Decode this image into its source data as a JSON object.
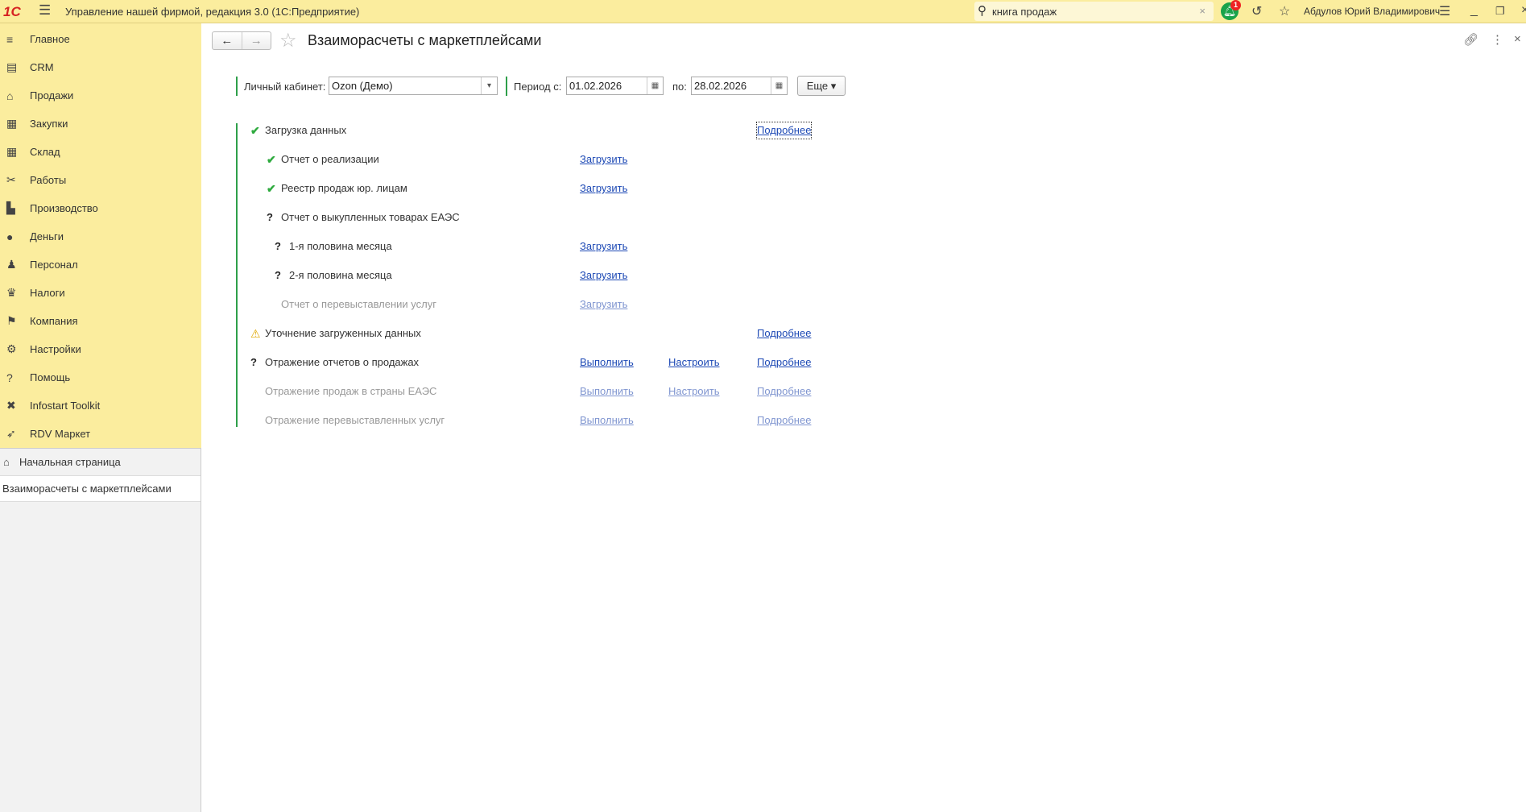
{
  "app": {
    "logo": "1С",
    "title": "Управление нашей фирмой, редакция 3.0  (1С:Предприятие)",
    "search_value": "книга продаж",
    "notifications": "1",
    "user": "Абдулов Юрий Владимирович"
  },
  "sidebar": {
    "items": [
      {
        "label": "Главное",
        "icon": "≡"
      },
      {
        "label": "CRM",
        "icon": "▤"
      },
      {
        "label": "Продажи",
        "icon": "⌂"
      },
      {
        "label": "Закупки",
        "icon": "▦"
      },
      {
        "label": "Склад",
        "icon": "▦"
      },
      {
        "label": "Работы",
        "icon": "✂"
      },
      {
        "label": "Производство",
        "icon": "▙"
      },
      {
        "label": "Деньги",
        "icon": "●"
      },
      {
        "label": "Персонал",
        "icon": "♟"
      },
      {
        "label": "Налоги",
        "icon": "♛"
      },
      {
        "label": "Компания",
        "icon": "⚑"
      },
      {
        "label": "Настройки",
        "icon": "⚙"
      },
      {
        "label": "Помощь",
        "icon": "?"
      },
      {
        "label": "Infostart Toolkit",
        "icon": "✖"
      },
      {
        "label": "RDV Маркет",
        "icon": "➶"
      }
    ],
    "home": "Начальная страница",
    "open_form": "Взаиморасчеты с маркетплейсами"
  },
  "form": {
    "title": "Взаиморасчеты с маркетплейсами",
    "cabinet_label": "Личный кабинет:",
    "cabinet_value": "Ozon (Демо)",
    "period_from_label": "Период с:",
    "period_from": "01.02.2026",
    "period_to_label": "по:",
    "period_to": "28.02.2026",
    "more_label": "Еще"
  },
  "tree": [
    {
      "text": "Загрузка данных",
      "status": "ok",
      "level": 0,
      "links": [
        "",
        "",
        "Подробнее"
      ]
    },
    {
      "text": "Отчет о реализации",
      "status": "ok",
      "level": 1,
      "links": [
        "Загрузить",
        "",
        ""
      ]
    },
    {
      "text": "Реестр продаж юр. лицам",
      "status": "ok",
      "level": 1,
      "links": [
        "Загрузить",
        "",
        ""
      ]
    },
    {
      "text": "Отчет о выкупленных товарах ЕАЭС",
      "status": "question",
      "level": 1,
      "links": [
        "",
        "",
        ""
      ]
    },
    {
      "text": "1-я половина месяца",
      "status": "question",
      "level": 2,
      "links": [
        "Загрузить",
        "",
        ""
      ]
    },
    {
      "text": "2-я половина месяца",
      "status": "question",
      "level": 2,
      "links": [
        "Загрузить",
        "",
        ""
      ]
    },
    {
      "text": "Отчет о перевыставлении услуг",
      "status": "disabled",
      "level": 1,
      "links": [
        "Загрузить",
        "",
        ""
      ]
    },
    {
      "text": "Уточнение загруженных данных",
      "status": "warning",
      "level": 0,
      "links": [
        "",
        "",
        "Подробнее"
      ]
    },
    {
      "text": "Отражение отчетов о продажах",
      "status": "question",
      "level": 0,
      "links": [
        "Выполнить",
        "Настроить",
        "Подробнее"
      ]
    },
    {
      "text": "Отражение продаж в страны ЕАЭС",
      "status": "disabled",
      "level": 0,
      "links": [
        "Выполнить",
        "Настроить",
        "Подробнее"
      ]
    },
    {
      "text": "Отражение перевыставленных услуг",
      "status": "disabled",
      "level": 0,
      "links": [
        "Выполнить",
        "",
        "Подробнее"
      ]
    }
  ]
}
